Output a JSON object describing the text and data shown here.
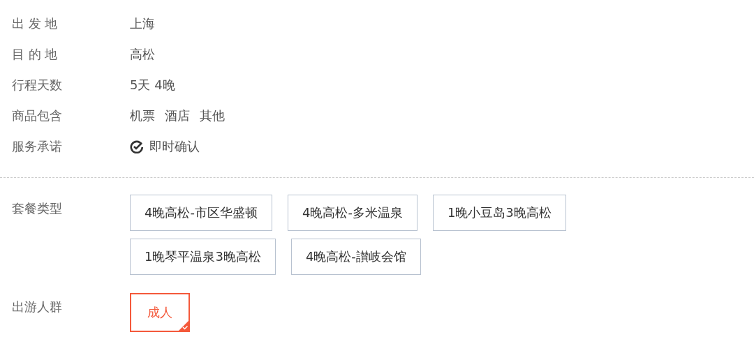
{
  "info": [
    {
      "label": "出 发 地",
      "kind": "text",
      "values": [
        "上海"
      ]
    },
    {
      "label": "目 的 地",
      "kind": "text",
      "values": [
        "高松"
      ]
    },
    {
      "label": "行程天数",
      "kind": "text",
      "values": [
        "5天 4晚"
      ]
    },
    {
      "label": "商品包含",
      "kind": "text",
      "values": [
        "机票",
        "酒店",
        "其他"
      ]
    },
    {
      "label": "服务承诺",
      "kind": "check",
      "values": [
        "即时确认"
      ]
    }
  ],
  "options": [
    {
      "label": "套餐类型",
      "choices": [
        {
          "label": "4晚高松-市区华盛顿",
          "selected": false
        },
        {
          "label": "4晚高松-多米温泉",
          "selected": false
        },
        {
          "label": "1晚小豆岛3晚高松",
          "selected": false
        },
        {
          "label": "1晚琴平温泉3晚高松",
          "selected": false
        },
        {
          "label": "4晚高松-讃岐会馆",
          "selected": false
        }
      ]
    },
    {
      "label": "出游人群",
      "choices": [
        {
          "label": "成人",
          "selected": true
        }
      ]
    }
  ]
}
